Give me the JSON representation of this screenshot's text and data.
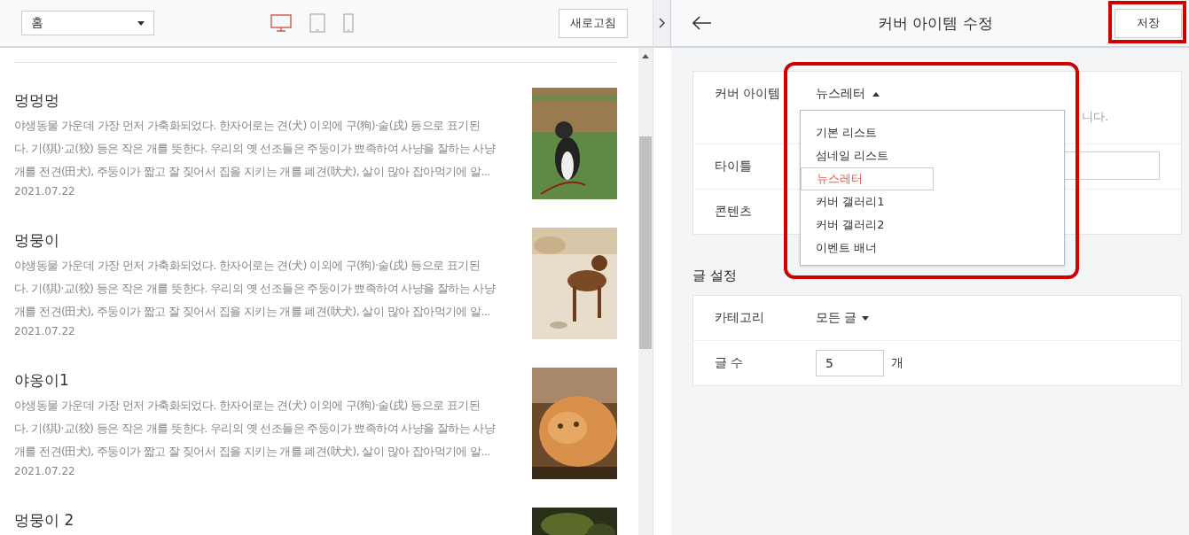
{
  "preview": {
    "page_select": "홈",
    "devices": [
      {
        "kind": "desktop",
        "selected": true
      },
      {
        "kind": "tablet",
        "selected": false
      },
      {
        "kind": "mobile",
        "selected": false
      }
    ],
    "refresh_button": "새로고침",
    "posts": [
      {
        "title": "멍멍멍",
        "lines": [
          "야생동물 가운데 가장 먼저 가축화되었다. 한자어로는 견(犬) 이외에 구(狗)·술(戌) 등으로 표기된",
          "다. 기(猉)·교(狡) 등은 작은 개를 뜻한다. 우리의 옛 선조들은 주둥이가 뾰족하여 사냥을 잘하는 사냥",
          "개를 전견(田犬), 주둥이가 짧고 잘 짖어서 집을 지키는 개를 폐견(吠犬), 살이 많아 잡아먹기에 알..."
        ],
        "date": "2021.07.22",
        "image": {
          "kind": "picture"
        }
      },
      {
        "title": "멍뭉이",
        "lines": [
          "야생동물 가운데 가장 먼저 가축화되었다. 한자어로는 견(犬) 이외에 구(狗)·술(戌) 등으로 표기된",
          "다. 기(猉)·교(狡) 등은 작은 개를 뜻한다. 우리의 옛 선조들은 주둥이가 뾰족하여 사냥을 잘하는 사냥",
          "개를 전견(田犬), 주둥이가 짧고 잘 짖어서 집을 지키는 개를 폐견(吠犬), 살이 많아 잡아먹기에 알..."
        ],
        "date": "2021.07.22",
        "image": {
          "kind": "picture"
        }
      },
      {
        "title": "야옹이1",
        "lines": [
          "야생동물 가운데 가장 먼저 가축화되었다. 한자어로는 견(犬) 이외에 구(狗)·술(戌) 등으로 표기된",
          "다. 기(猉)·교(狡) 등은 작은 개를 뜻한다. 우리의 옛 선조들은 주둥이가 뾰족하여 사냥을 잘하는 사냥",
          "개를 전견(田犬), 주둥이가 짧고 잘 짖어서 집을 지키는 개를 폐견(吠犬), 살이 많아 잡아먹기에 알..."
        ],
        "date": "2021.07.22",
        "image": {
          "kind": "picture"
        }
      },
      {
        "title": "멍뭉이 2",
        "image": {
          "kind": "picture"
        }
      }
    ]
  },
  "editor": {
    "title": "커버 아이템 수정",
    "save_button": "저장",
    "cover_item": {
      "label": "커버 아이템",
      "value": "뉴스레터",
      "hint": "니다.",
      "options": [
        {
          "label": "기본 리스트",
          "selected": false
        },
        {
          "label": "섬네일 리스트",
          "selected": false
        },
        {
          "label": "뉴스레터",
          "selected": true
        },
        {
          "label": "커버 갤러리1",
          "selected": false
        },
        {
          "label": "커버 갤러리2",
          "selected": false
        },
        {
          "label": "이벤트 배너",
          "selected": false
        }
      ]
    },
    "title_field": {
      "label": "타이틀"
    },
    "content_field": {
      "label": "콘텐츠"
    },
    "post_settings": {
      "heading": "글 설정",
      "category": {
        "label": "카테고리",
        "value": "모든 글"
      },
      "count": {
        "label": "글 수",
        "value": "5",
        "unit": "개"
      }
    }
  }
}
